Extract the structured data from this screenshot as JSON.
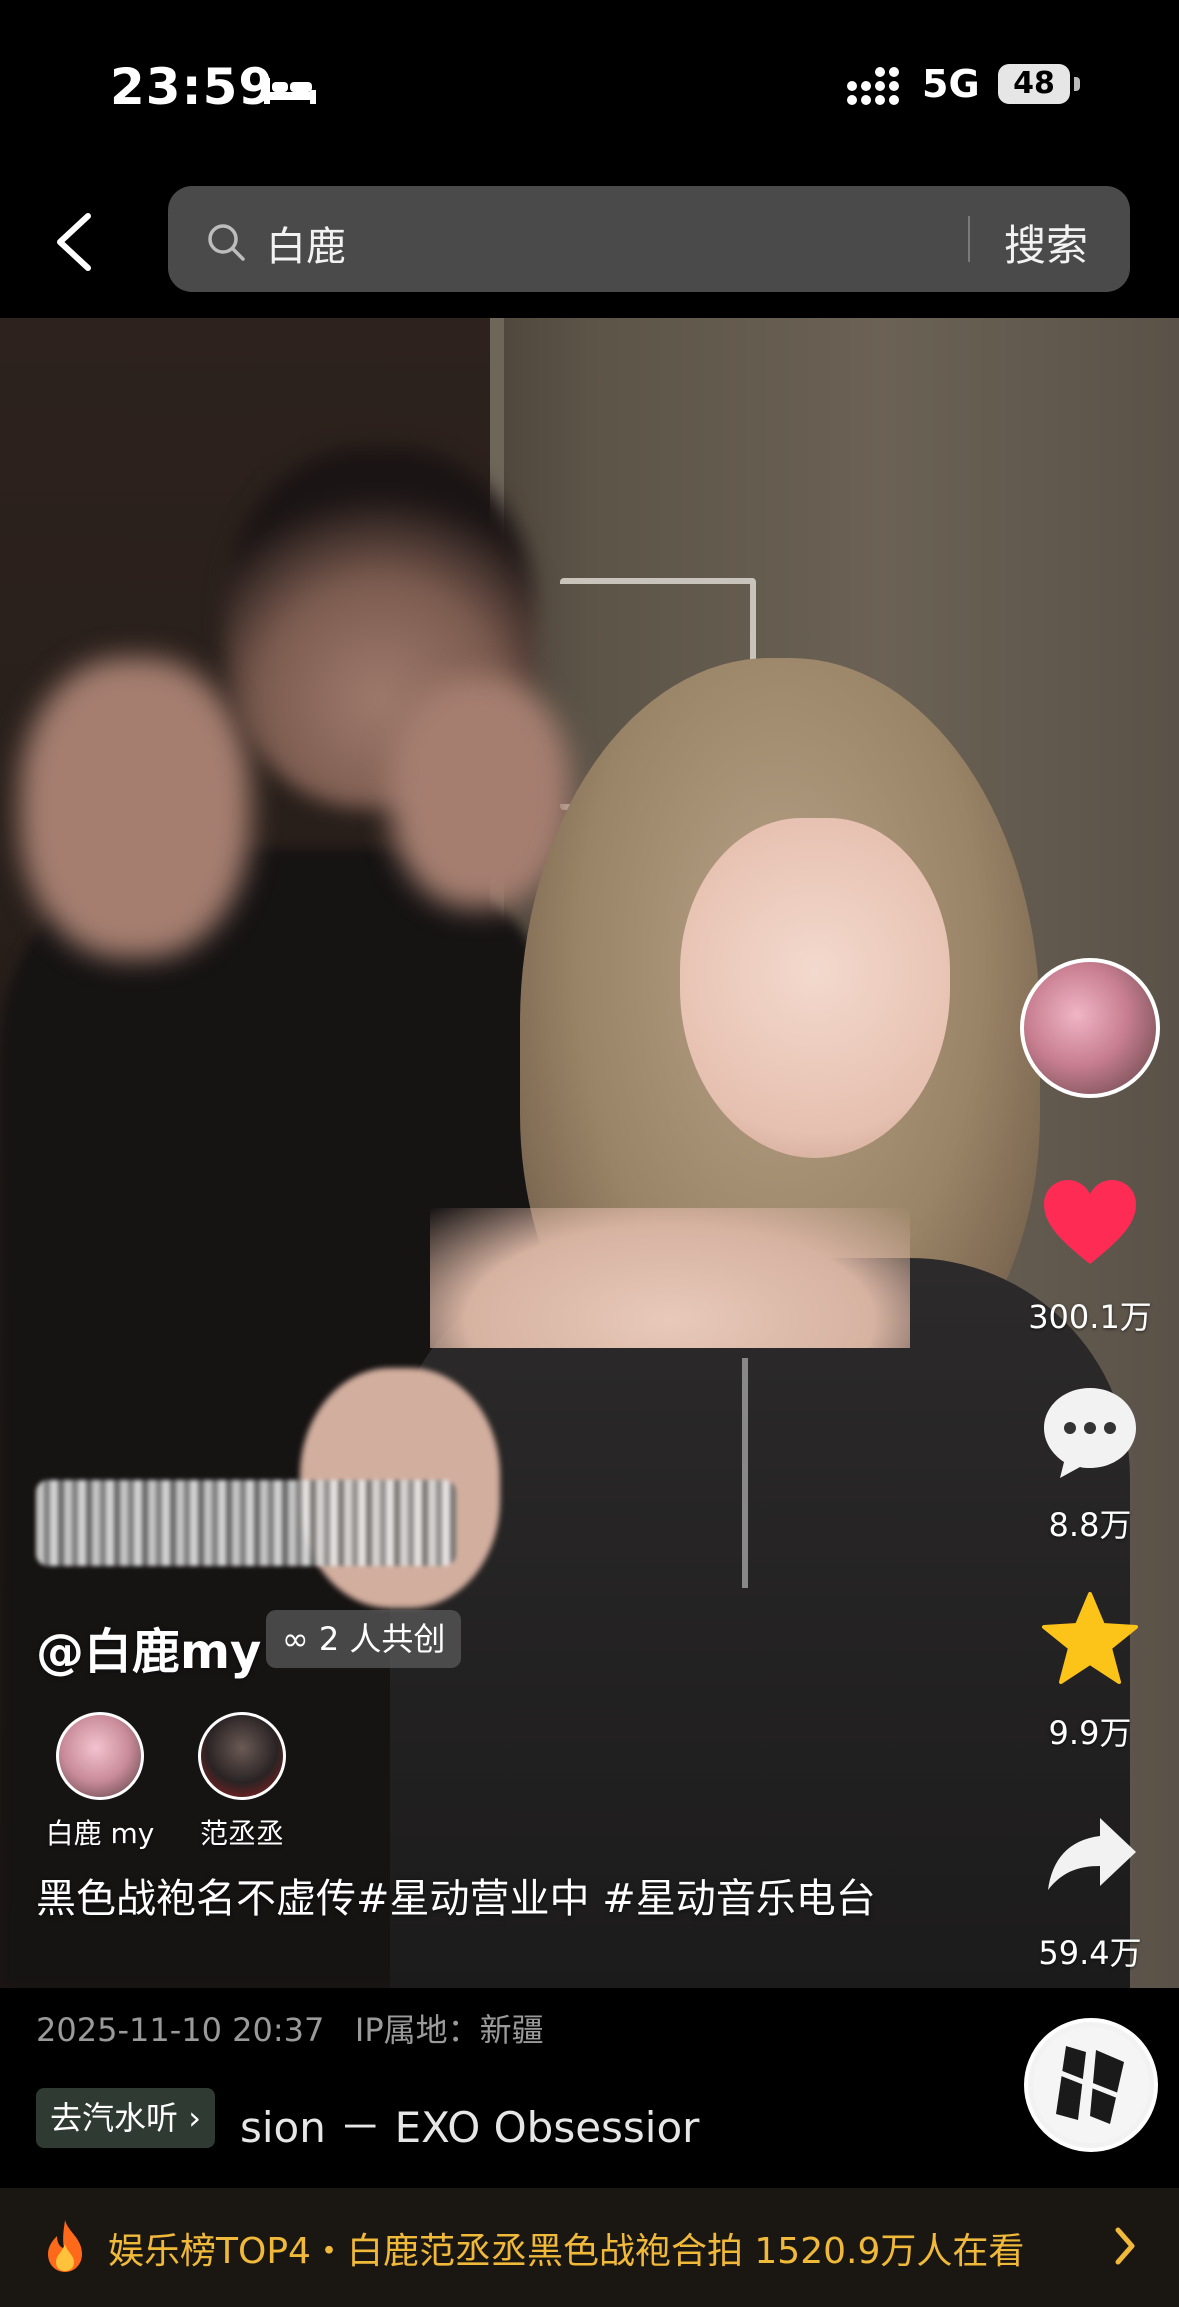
{
  "status_bar": {
    "time": "23:59",
    "network": "5G",
    "battery": "48"
  },
  "search": {
    "query": "白鹿",
    "button": "搜索"
  },
  "actions": {
    "likes": "300.1万",
    "comments": "8.8万",
    "favorites": "9.9万",
    "shares": "59.4万"
  },
  "post": {
    "author": "@白鹿my",
    "cocreate": "2 人共创",
    "cocreators": [
      {
        "name": "白鹿 my"
      },
      {
        "name": "范丞丞"
      }
    ],
    "description": "黑色战袍名不虚传#星动营业中 #星动音乐电台",
    "datetime": "2025-11-10 20:37",
    "ip": "IP属地：新疆"
  },
  "music": {
    "listen_button": "去汽水听",
    "title": "sion － EXO    Obsessior"
  },
  "hot_bar": {
    "text": "娱乐榜TOP4・白鹿范丞丞黑色战袍合拍  1520.9万人在看"
  },
  "colors": {
    "heart": "#fe2c55",
    "star": "#fcc419",
    "hot_text": "#f0b93a"
  }
}
